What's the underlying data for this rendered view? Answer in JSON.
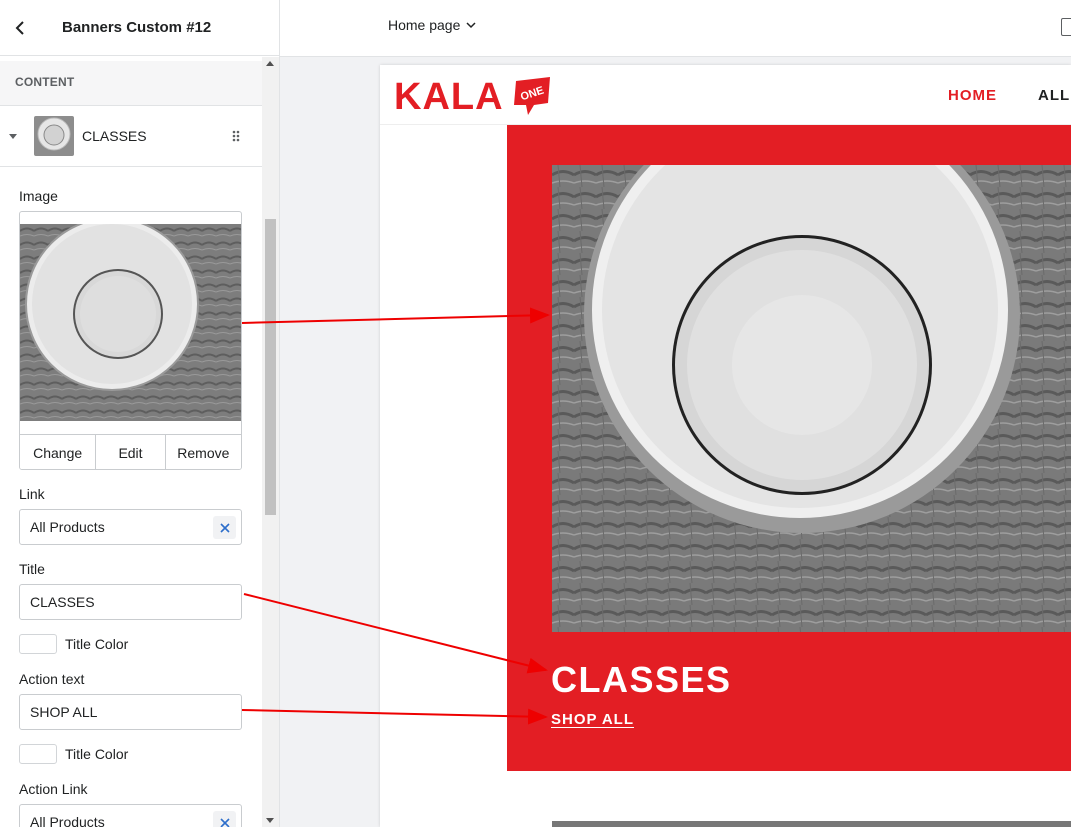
{
  "sidebar": {
    "title": "Banners Custom #12",
    "section_label": "CONTENT",
    "block": {
      "name": "CLASSES"
    },
    "image_field": {
      "label": "Image",
      "change_label": "Change",
      "edit_label": "Edit",
      "remove_label": "Remove"
    },
    "link_field": {
      "label": "Link",
      "value": "All Products"
    },
    "title_field": {
      "label": "Title",
      "value": "CLASSES"
    },
    "title_color_1": {
      "label": "Title Color"
    },
    "action_text_field": {
      "label": "Action text",
      "value": "SHOP ALL"
    },
    "title_color_2": {
      "label": "Title Color"
    },
    "action_link_field": {
      "label": "Action Link",
      "value": "All Products"
    }
  },
  "topbar": {
    "page_selector": "Home page"
  },
  "preview": {
    "logo_text": "KALA",
    "logo_badge": "ONE",
    "nav": {
      "home": "HOME",
      "all": "ALL C"
    },
    "banner": {
      "title": "CLASSES",
      "action": "SHOP ALL"
    }
  },
  "colors": {
    "brand_red": "#e31e24",
    "arrow_red": "#ee0000"
  },
  "icons": [
    "back-arrow-icon",
    "caret-down-icon",
    "drag-handle-icon",
    "clear-x-icon",
    "chevron-down-icon",
    "device-preview-icon"
  ]
}
